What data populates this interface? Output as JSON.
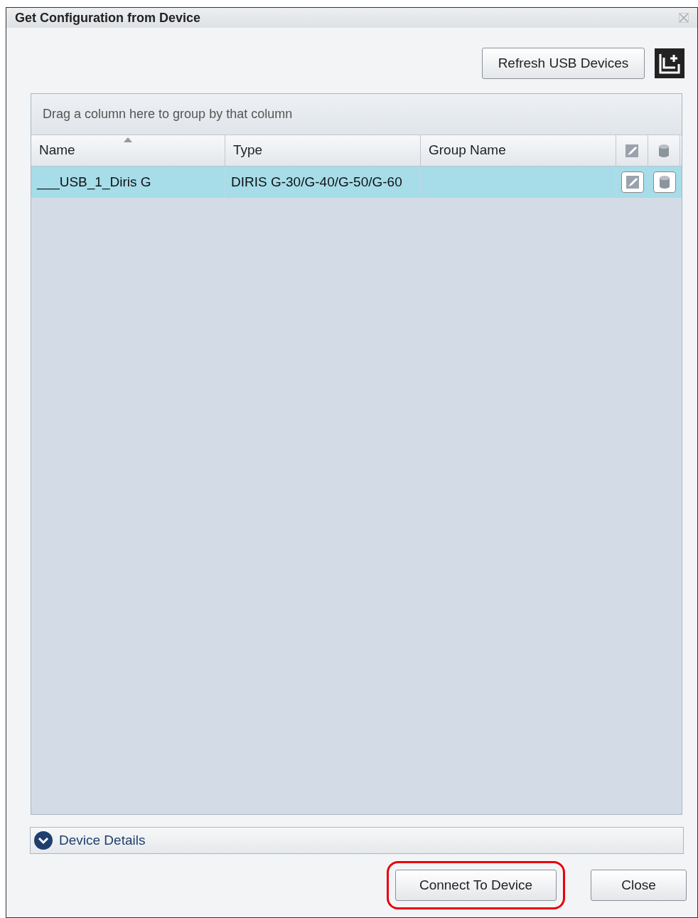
{
  "window": {
    "title": "Get Configuration from Device"
  },
  "toolbar": {
    "refresh_button": "Refresh USB Devices"
  },
  "grid": {
    "group_by_hint": "Drag a column here to group by that column",
    "columns": [
      {
        "label": "Name",
        "sorted": true
      },
      {
        "label": "Type",
        "sorted": false
      },
      {
        "label": "Group Name",
        "sorted": false
      }
    ],
    "rows": [
      {
        "name": "___USB_1_Diris G",
        "type": "DIRIS G-30/G-40/G-50/G-60",
        "group_name": "",
        "selected": true
      }
    ]
  },
  "details": {
    "label": "Device Details",
    "expanded": false
  },
  "buttons": [
    {
      "label": "Connect To Device",
      "highlighted": true
    },
    {
      "label": "Close",
      "highlighted": false
    }
  ]
}
